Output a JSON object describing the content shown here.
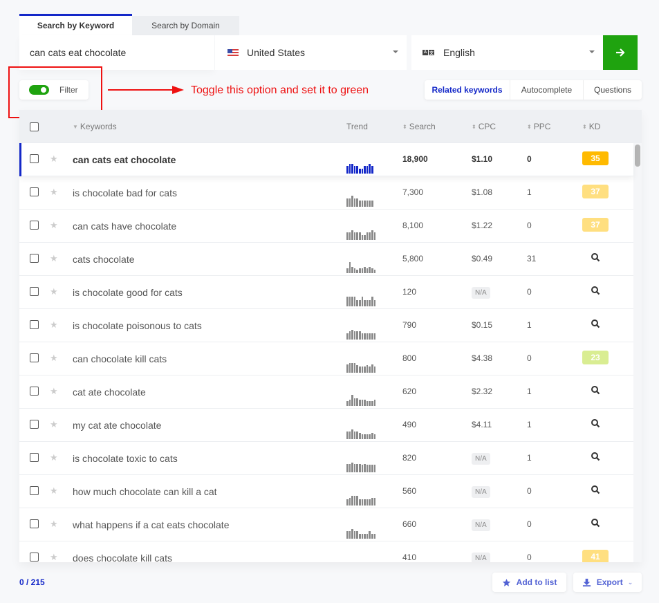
{
  "tabs": [
    {
      "label": "Search by Keyword",
      "active": true
    },
    {
      "label": "Search by Domain",
      "active": false
    }
  ],
  "search": {
    "keyword_value": "can cats eat chocolate",
    "country": "United States",
    "language": "English",
    "go_icon": "arrow-right-icon"
  },
  "filter": {
    "label": "Filter",
    "enabled": true,
    "toggle_color": "#1fa30f"
  },
  "annotation": {
    "text": "Toggle this option and set it to green",
    "color": "#ee1111"
  },
  "mode_tabs": [
    {
      "label": "Related keywords",
      "active": true
    },
    {
      "label": "Autocomplete",
      "active": false
    },
    {
      "label": "Questions",
      "active": false
    }
  ],
  "table": {
    "headers": {
      "keywords": "Keywords",
      "trend": "Trend",
      "search": "Search",
      "cpc": "CPC",
      "ppc": "PPC",
      "kd": "KD"
    },
    "rows": [
      {
        "keyword": "can cats eat chocolate",
        "search": "18,900",
        "cpc": "$1.10",
        "ppc": "0",
        "kd": "35",
        "kd_color": "#ffba00",
        "selected": true,
        "trend": [
          6,
          8,
          8,
          6,
          6,
          4,
          4,
          6,
          6,
          8,
          6
        ]
      },
      {
        "keyword": "is chocolate bad for cats",
        "search": "7,300",
        "cpc": "$1.08",
        "ppc": "1",
        "kd": "37",
        "kd_color": "#ffdf80",
        "selected": false,
        "trend": [
          7,
          7,
          9,
          7,
          7,
          5,
          5,
          5,
          5,
          5,
          5
        ]
      },
      {
        "keyword": "can cats have chocolate",
        "search": "8,100",
        "cpc": "$1.22",
        "ppc": "0",
        "kd": "37",
        "kd_color": "#ffdf80",
        "selected": false,
        "trend": [
          6,
          6,
          8,
          6,
          6,
          6,
          4,
          4,
          6,
          6,
          8,
          6
        ]
      },
      {
        "keyword": "cats chocolate",
        "search": "5,800",
        "cpc": "$0.49",
        "ppc": "31",
        "kd": null,
        "selected": false,
        "trend": [
          4,
          9,
          5,
          4,
          3,
          4,
          4,
          5,
          4,
          5,
          4,
          3
        ]
      },
      {
        "keyword": "is chocolate good for cats",
        "search": "120",
        "cpc": "N/A",
        "ppc": "0",
        "kd": null,
        "selected": false,
        "trend": [
          8,
          8,
          8,
          8,
          5,
          5,
          8,
          5,
          5,
          5,
          8,
          5
        ]
      },
      {
        "keyword": "is chocolate poisonous to cats",
        "search": "790",
        "cpc": "$0.15",
        "ppc": "1",
        "kd": null,
        "selected": false,
        "trend": [
          5,
          7,
          8,
          7,
          7,
          7,
          5,
          5,
          5,
          5,
          5,
          5
        ]
      },
      {
        "keyword": "can chocolate kill cats",
        "search": "800",
        "cpc": "$4.38",
        "ppc": "0",
        "kd": "23",
        "kd_color": "#d9ed92",
        "selected": false,
        "trend": [
          7,
          8,
          8,
          8,
          6,
          5,
          5,
          5,
          6,
          5,
          7,
          5
        ]
      },
      {
        "keyword": "cat ate chocolate",
        "search": "620",
        "cpc": "$2.32",
        "ppc": "1",
        "kd": null,
        "selected": false,
        "trend": [
          4,
          5,
          9,
          6,
          6,
          5,
          5,
          5,
          4,
          4,
          4,
          5
        ]
      },
      {
        "keyword": "my cat ate chocolate",
        "search": "490",
        "cpc": "$4.11",
        "ppc": "1",
        "kd": null,
        "selected": false,
        "trend": [
          6,
          6,
          8,
          6,
          6,
          5,
          4,
          4,
          4,
          4,
          5,
          4
        ]
      },
      {
        "keyword": "is chocolate toxic to cats",
        "search": "820",
        "cpc": "N/A",
        "ppc": "1",
        "kd": null,
        "selected": false,
        "trend": [
          7,
          7,
          8,
          7,
          7,
          7,
          6,
          7,
          6,
          6,
          6,
          6
        ]
      },
      {
        "keyword": "how much chocolate can kill a cat",
        "search": "560",
        "cpc": "N/A",
        "ppc": "0",
        "kd": null,
        "selected": false,
        "trend": [
          5,
          6,
          8,
          8,
          8,
          5,
          5,
          5,
          5,
          5,
          6,
          6
        ]
      },
      {
        "keyword": "what happens if a cat eats chocolate",
        "search": "660",
        "cpc": "N/A",
        "ppc": "0",
        "kd": null,
        "selected": false,
        "trend": [
          6,
          6,
          8,
          6,
          6,
          4,
          4,
          4,
          4,
          6,
          4,
          4
        ]
      },
      {
        "keyword": "does chocolate kill cats",
        "search": "410",
        "cpc": "N/A",
        "ppc": "0",
        "kd": "41",
        "kd_color": "#ffdf80",
        "selected": false,
        "trend": []
      }
    ]
  },
  "footer": {
    "counter": "0 / 215",
    "add_to_list": "Add to list",
    "export": "Export"
  },
  "colors": {
    "accent": "#1428c8",
    "go_button": "#1fa30f"
  }
}
